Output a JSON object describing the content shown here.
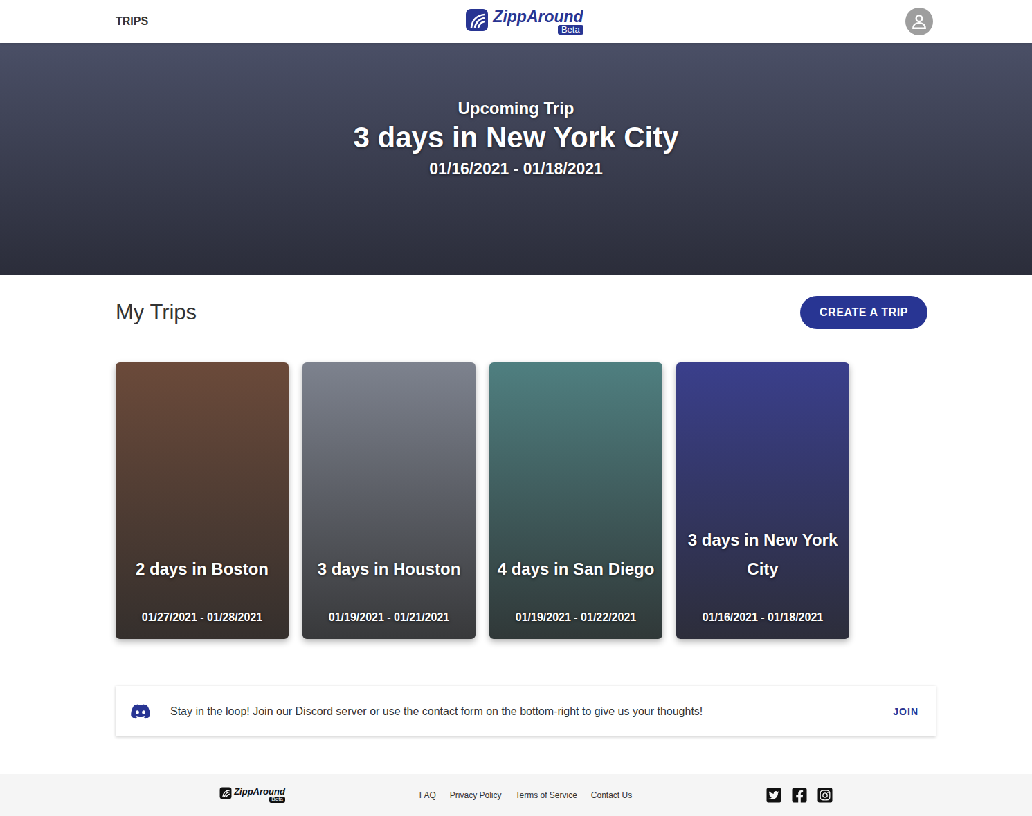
{
  "header": {
    "nav": [
      {
        "label": "TRIPS"
      }
    ],
    "logo": {
      "name": "ZippAround",
      "badge": "Beta"
    }
  },
  "hero": {
    "kicker": "Upcoming Trip",
    "title": "3 days in New York City",
    "dates": "01/16/2021 - 01/18/2021",
    "color": "#4a4f66"
  },
  "trips": {
    "title": "My Trips",
    "create": "CREATE A TRIP",
    "cards": [
      {
        "title": "2 days in Boston",
        "dates": "01/27/2021 - 01/28/2021",
        "color": "#6b4a3a"
      },
      {
        "title": "3 days in Houston",
        "dates": "01/19/2021 - 01/21/2021",
        "color": "#7d828e"
      },
      {
        "title": "4 days in San Diego",
        "dates": "01/19/2021 - 01/22/2021",
        "color": "#4f7f80"
      },
      {
        "title": "3 days in New York City",
        "dates": "01/16/2021 - 01/18/2021",
        "color": "#3a3f8c"
      }
    ]
  },
  "notice": {
    "text": "Stay in the loop! Join our Discord server or use the contact form on the bottom-right to give us your thoughts!",
    "action": "JOIN"
  },
  "footer": {
    "logo": {
      "name": "ZippAround",
      "badge": "Beta"
    },
    "links": [
      "FAQ",
      "Privacy Policy",
      "Terms of Service",
      "Contact Us"
    ]
  }
}
